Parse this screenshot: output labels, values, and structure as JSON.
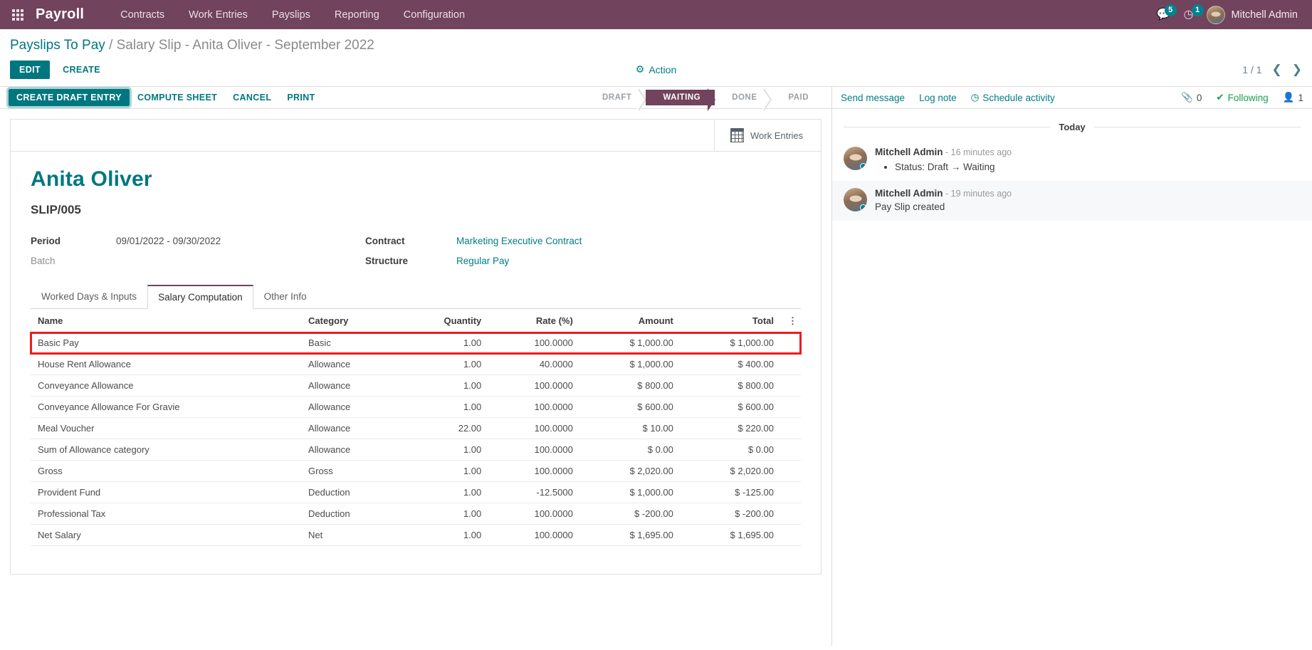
{
  "navbar": {
    "apps_icon": "apps-grid-icon",
    "brand": "Payroll",
    "menus": [
      "Contracts",
      "Work Entries",
      "Payslips",
      "Reporting",
      "Configuration"
    ],
    "messaging_icon": "chat-bubble-icon",
    "messaging_count": "5",
    "activity_icon": "clock-icon",
    "activity_count": "1",
    "user_name": "Mitchell Admin",
    "brand_color": "#71435c",
    "accent_color": "#00777f"
  },
  "control_panel": {
    "breadcrumb_root": "Payslips To Pay",
    "breadcrumb_sep": "/",
    "breadcrumb_current": "Salary Slip - Anita Oliver - September 2022",
    "edit_label": "EDIT",
    "create_label": "CREATE",
    "action_icon": "gear-icon",
    "action_label": "Action",
    "pager_value": "1 / 1",
    "prev_icon": "chevron-left-icon",
    "next_icon": "chevron-right-icon"
  },
  "form_buttons": {
    "create_draft_entry": "CREATE DRAFT ENTRY",
    "compute_sheet": "COMPUTE SHEET",
    "cancel": "CANCEL",
    "print": "PRINT"
  },
  "statusbar": {
    "stages": [
      "DRAFT",
      "WAITING",
      "DONE",
      "PAID"
    ],
    "active": "WAITING",
    "active_color": "#71435c"
  },
  "stat_buttons": [
    {
      "icon": "calendar-icon",
      "label": "Work Entries"
    }
  ],
  "record": {
    "title": "Anita Oliver",
    "reference": "SLIP/005",
    "fields": {
      "period_label": "Period",
      "period_value": "09/01/2022 - 09/30/2022",
      "batch_label": "Batch",
      "batch_value": "",
      "contract_label": "Contract",
      "contract_value": "Marketing Executive Contract",
      "structure_label": "Structure",
      "structure_value": "Regular Pay"
    }
  },
  "notebook": {
    "tabs": [
      {
        "label": "Worked Days & Inputs",
        "active": false
      },
      {
        "label": "Salary Computation",
        "active": true
      },
      {
        "label": "Other Info",
        "active": false
      }
    ]
  },
  "salary_table": {
    "columns": [
      "Name",
      "Category",
      "Quantity",
      "Rate (%)",
      "Amount",
      "Total"
    ],
    "optional_columns_icon": "vertical-dots-icon",
    "highlighted_row_index": 0,
    "highlight_color": "#ee1c1c",
    "rows": [
      {
        "name": "Basic Pay",
        "category": "Basic",
        "quantity": "1.00",
        "rate": "100.0000",
        "amount": "$ 1,000.00",
        "total": "$ 1,000.00",
        "linked": false
      },
      {
        "name": "House Rent Allowance",
        "category": "Allowance",
        "quantity": "1.00",
        "rate": "40.0000",
        "amount": "$ 1,000.00",
        "total": "$ 400.00",
        "linked": false
      },
      {
        "name": "Conveyance Allowance",
        "category": "Allowance",
        "quantity": "1.00",
        "rate": "100.0000",
        "amount": "$ 800.00",
        "total": "$ 800.00",
        "linked": false
      },
      {
        "name": "Conveyance Allowance For Gravie",
        "category": "Allowance",
        "quantity": "1.00",
        "rate": "100.0000",
        "amount": "$ 600.00",
        "total": "$ 600.00",
        "linked": false
      },
      {
        "name": "Meal Voucher",
        "category": "Allowance",
        "quantity": "22.00",
        "rate": "100.0000",
        "amount": "$ 10.00",
        "total": "$ 220.00",
        "linked": false
      },
      {
        "name": "Sum of Allowance category",
        "category": "Allowance",
        "quantity": "1.00",
        "rate": "100.0000",
        "amount": "$ 0.00",
        "total": "$ 0.00",
        "linked": true
      },
      {
        "name": "Gross",
        "category": "Gross",
        "quantity": "1.00",
        "rate": "100.0000",
        "amount": "$ 2,020.00",
        "total": "$ 2,020.00",
        "linked": false
      },
      {
        "name": "Provident Fund",
        "category": "Deduction",
        "quantity": "1.00",
        "rate": "-12.5000",
        "amount": "$ 1,000.00",
        "total": "$ -125.00",
        "linked": false
      },
      {
        "name": "Professional Tax",
        "category": "Deduction",
        "quantity": "1.00",
        "rate": "100.0000",
        "amount": "$ -200.00",
        "total": "$ -200.00",
        "linked": false
      },
      {
        "name": "Net Salary",
        "category": "Net",
        "quantity": "1.00",
        "rate": "100.0000",
        "amount": "$ 1,695.00",
        "total": "$ 1,695.00",
        "linked": false
      }
    ]
  },
  "chatter": {
    "send_message": "Send message",
    "log_note": "Log note",
    "schedule_activity_icon": "clock-icon",
    "schedule_activity": "Schedule activity",
    "attachment_icon": "paperclip-icon",
    "attachment_count": "0",
    "following_icon": "check-icon",
    "following_label": "Following",
    "followers_icon": "user-icon",
    "followers_count": "1",
    "day_separator": "Today",
    "messages": [
      {
        "author": "Mitchell Admin",
        "time": "- 16 minutes ago",
        "tracking": "Status: Draft → Waiting",
        "body": ""
      },
      {
        "author": "Mitchell Admin",
        "time": "- 19 minutes ago",
        "tracking": "",
        "body": "Pay Slip created"
      }
    ]
  }
}
